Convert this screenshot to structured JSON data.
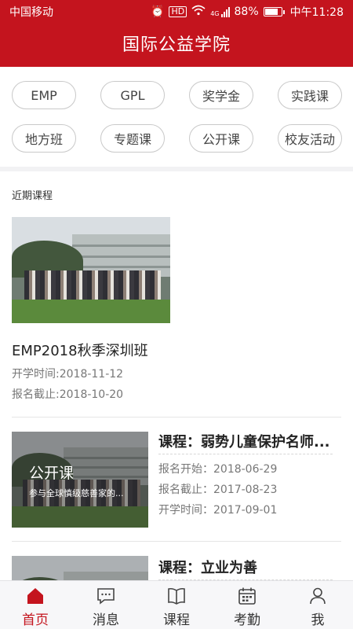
{
  "status_bar": {
    "carrier": "中国移动",
    "hd": "HD",
    "network": "4G",
    "battery": "88%",
    "battery_level": 0.88,
    "time": "中午11:28"
  },
  "header": {
    "title": "国际公益学院"
  },
  "categories": [
    {
      "label": "EMP"
    },
    {
      "label": "GPL"
    },
    {
      "label": "奖学金"
    },
    {
      "label": "实践课"
    },
    {
      "label": "地方班"
    },
    {
      "label": "专题课"
    },
    {
      "label": "公开课"
    },
    {
      "label": "校友活动"
    }
  ],
  "recent": {
    "section_title": "近期课程",
    "featured": {
      "title": "EMP2018秋季深圳班",
      "start": "开学时间:2018-11-12",
      "deadline": "报名截止:2018-10-20"
    },
    "courses": [
      {
        "title": "课程：弱势儿童保护名师...",
        "overlay_title": "公开课",
        "overlay_subtitle": "参与全球慎级慈善家的...",
        "reg_start": "报名开始：2018-06-29",
        "reg_end": "报名截止：2017-08-23",
        "start": "开学时间：2017-09-01"
      },
      {
        "title": "课程：立业为善"
      }
    ]
  },
  "tabs": [
    {
      "label": "首页",
      "icon": "home-icon",
      "active": true
    },
    {
      "label": "消息",
      "icon": "message-icon",
      "active": false
    },
    {
      "label": "课程",
      "icon": "book-icon",
      "active": false
    },
    {
      "label": "考勤",
      "icon": "calendar-icon",
      "active": false
    },
    {
      "label": "我",
      "icon": "user-icon",
      "active": false
    }
  ],
  "colors": {
    "brand": "#c4141e",
    "tab_inactive": "#333333"
  }
}
